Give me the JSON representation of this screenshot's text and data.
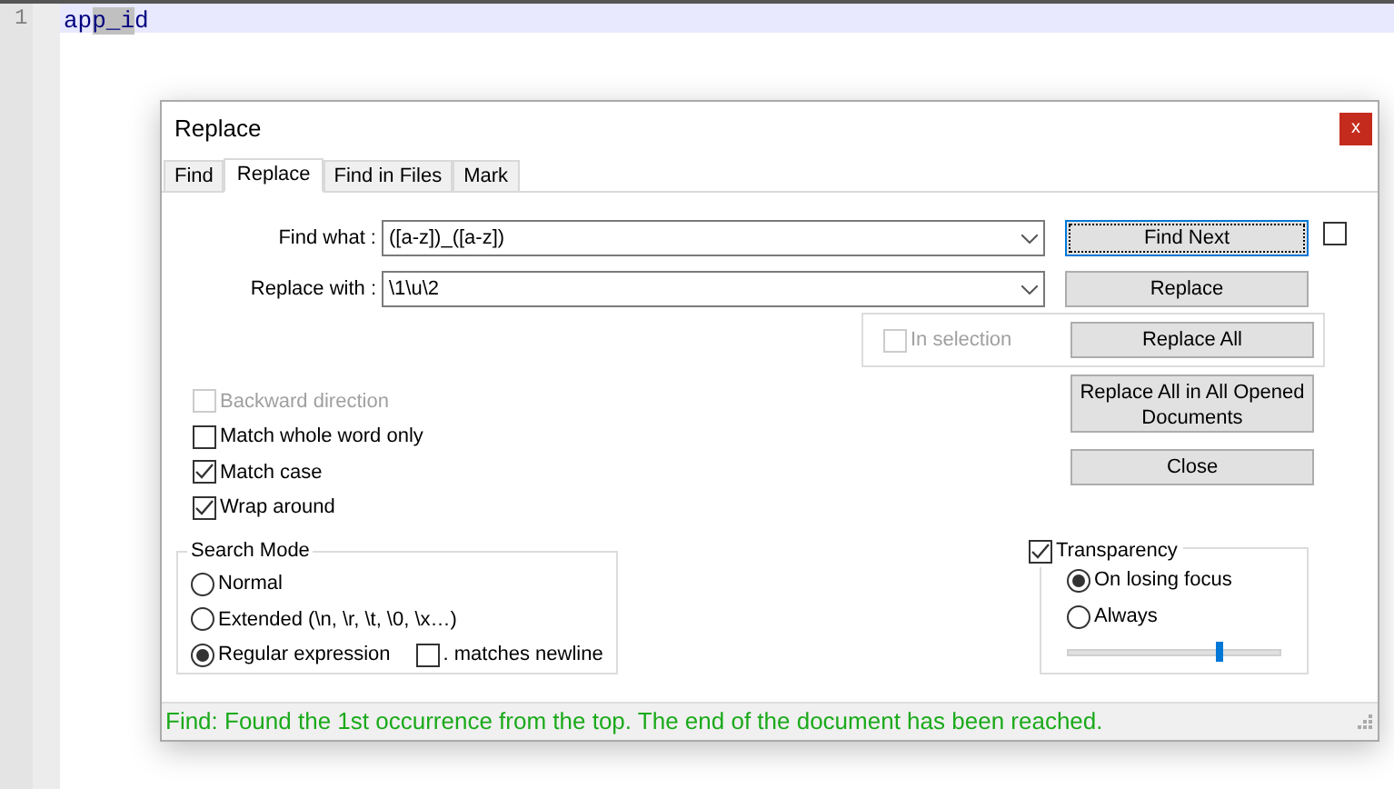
{
  "editor": {
    "line_number": "1",
    "line": {
      "before": "ap",
      "selected": "p_i",
      "after": "d"
    }
  },
  "dialog": {
    "title": "Replace",
    "close": "x",
    "tabs": [
      {
        "label": "Find",
        "selected": false
      },
      {
        "label": "Replace",
        "selected": true
      },
      {
        "label": "Find in Files",
        "selected": false
      },
      {
        "label": "Mark",
        "selected": false
      }
    ],
    "fields": [
      {
        "label": "Find what :",
        "value": "([a-z])_([a-z])"
      },
      {
        "label": "Replace with :",
        "value": "\\1\\u\\2"
      }
    ],
    "buttons": [
      {
        "label": "Find Next",
        "focused": true
      },
      {
        "label": "Replace",
        "focused": false
      },
      {
        "label": "Replace All",
        "focused": false
      },
      {
        "label": "Replace All in All Opened Documents",
        "focused": false
      },
      {
        "label": "Close",
        "focused": false
      }
    ],
    "side_checkbox": {
      "checked": false
    },
    "in_selection": {
      "label": "In selection",
      "checked": false,
      "disabled": true
    },
    "options": [
      {
        "label": "Backward direction",
        "checked": false,
        "disabled": true
      },
      {
        "label": "Match whole word only",
        "checked": false,
        "disabled": false
      },
      {
        "label": "Match case",
        "checked": true,
        "disabled": false
      },
      {
        "label": "Wrap around",
        "checked": true,
        "disabled": false
      }
    ],
    "search_mode": {
      "title": "Search Mode",
      "modes": [
        {
          "label": "Normal",
          "selected": false
        },
        {
          "label": "Extended (\\n, \\r, \\t, \\0, \\x…)",
          "selected": false
        },
        {
          "label": "Regular expression",
          "selected": true
        }
      ],
      "dot_newline": {
        "label": ". matches newline",
        "checked": false
      }
    },
    "transparency": {
      "label": "Transparency",
      "checked": true,
      "modes": [
        {
          "label": "On losing focus",
          "selected": true
        },
        {
          "label": "Always",
          "selected": false
        }
      ],
      "level": 0.71
    },
    "status": "Find: Found the 1st occurrence from the top. The end of the document has been reached."
  }
}
